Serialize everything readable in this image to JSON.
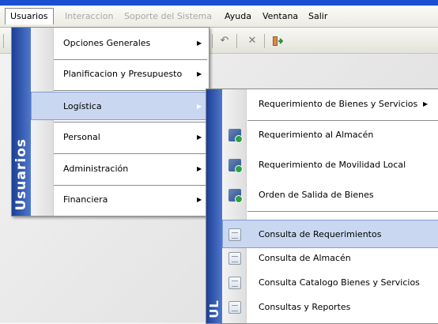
{
  "menubar": {
    "items": [
      {
        "label": "Usuarios",
        "state": "active"
      },
      {
        "label": "Interaccion",
        "state": "disabled"
      },
      {
        "label": "Soporte del Sistema",
        "state": "disabled"
      },
      {
        "label": "Ayuda",
        "state": "normal"
      },
      {
        "label": "Ventana",
        "state": "normal"
      },
      {
        "label": "Salir",
        "state": "normal"
      }
    ]
  },
  "toolbar": {
    "icons": [
      "undo-icon",
      "close-icon",
      "exit-icon"
    ]
  },
  "main_menu": {
    "stripe_label": "Usuarios",
    "items": [
      {
        "label": "Opciones Generales",
        "has_submenu": true
      },
      {
        "label": "Planificacion y Presupuesto",
        "has_submenu": true
      },
      {
        "label": "Logística",
        "has_submenu": true,
        "highlighted": true
      },
      {
        "label": "Personal",
        "has_submenu": true
      },
      {
        "label": "Administración",
        "has_submenu": true
      },
      {
        "label": "Financiera",
        "has_submenu": true
      }
    ]
  },
  "sub_menu": {
    "stripe_label": "UL",
    "items": [
      {
        "label": "Requerimiento de Bienes y Servicios",
        "has_submenu": true,
        "icon": "none"
      },
      {
        "label": "Requerimiento al Almacén",
        "icon": "chart-icon"
      },
      {
        "label": "Requerimiento de Movilidad Local",
        "icon": "chart-icon"
      },
      {
        "label": "Orden de Salida de Bienes",
        "icon": "chart-icon"
      },
      {
        "label": "Consulta de Requerimientos",
        "icon": "document-icon",
        "highlighted": true
      },
      {
        "label": "Consulta de Almacén",
        "icon": "document-icon"
      },
      {
        "label": "Consulta Catalogo Bienes y Servicios",
        "icon": "document-icon"
      },
      {
        "label": "Consultas y Reportes",
        "icon": "document-icon"
      }
    ]
  },
  "colors": {
    "title_blue": "#1a4fd0",
    "stripe_blue": "#1c3f95",
    "highlight": "#c9d7f1",
    "highlight_border": "#7f9dd7"
  }
}
